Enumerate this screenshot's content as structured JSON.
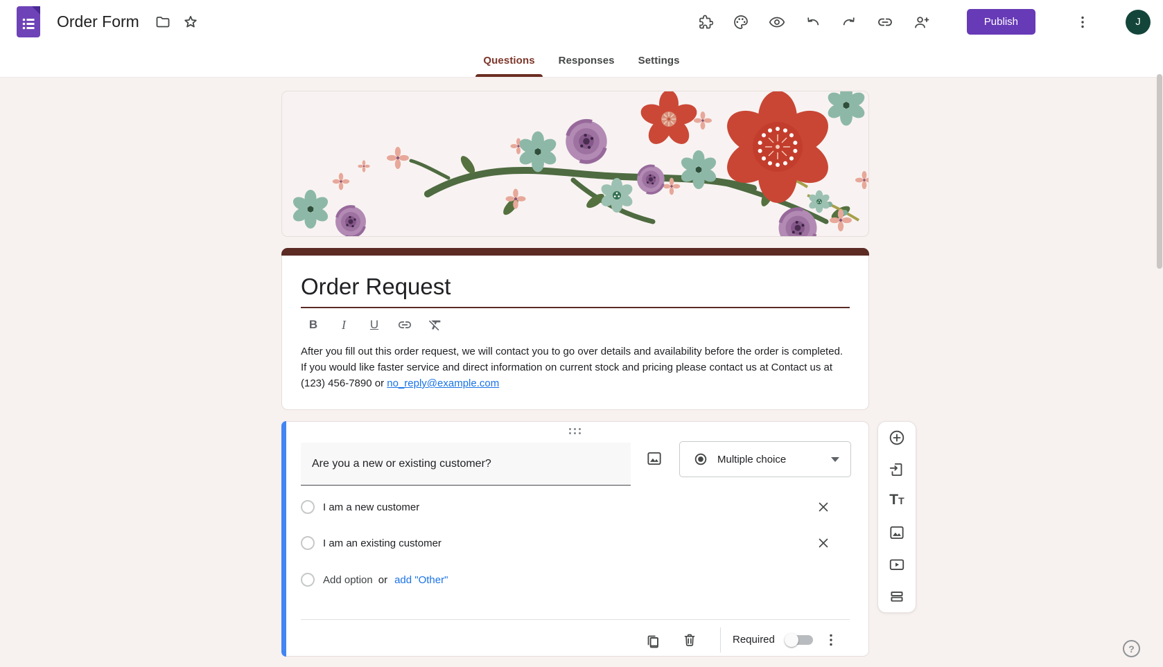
{
  "topbar": {
    "title": "Order Form",
    "publish": "Publish",
    "avatar": "J"
  },
  "tabs": {
    "questions": "Questions",
    "responses": "Responses",
    "settings": "Settings"
  },
  "format_toolbar": {
    "bold": "B",
    "italic": "I",
    "underline": "U"
  },
  "form": {
    "title": "Order Request",
    "description": "After you fill out this order request, we will contact you to go over details and availability before the order is completed. If you would like faster service and direct information on current stock and pricing please contact us at Contact us at (123) 456-7890 or ",
    "description_link": "no_reply@example.com"
  },
  "question": {
    "title": "Are you a new or existing customer?",
    "type": "Multiple choice",
    "options": [
      "I am a new customer",
      "I am an existing customer"
    ],
    "add_option": "Add option",
    "or_text": "or",
    "add_other": "add \"Other\"",
    "required": "Required"
  },
  "side_toolbar": {
    "tt_large": "T",
    "tt_small": "T"
  },
  "help": "?",
  "colors": {
    "theme_dark": "#5b2b24",
    "selected_question_blue": "#4285f4",
    "link_blue": "#1a73e8",
    "publish_purple": "#673ab7",
    "page_background": "#f7f1ef"
  }
}
